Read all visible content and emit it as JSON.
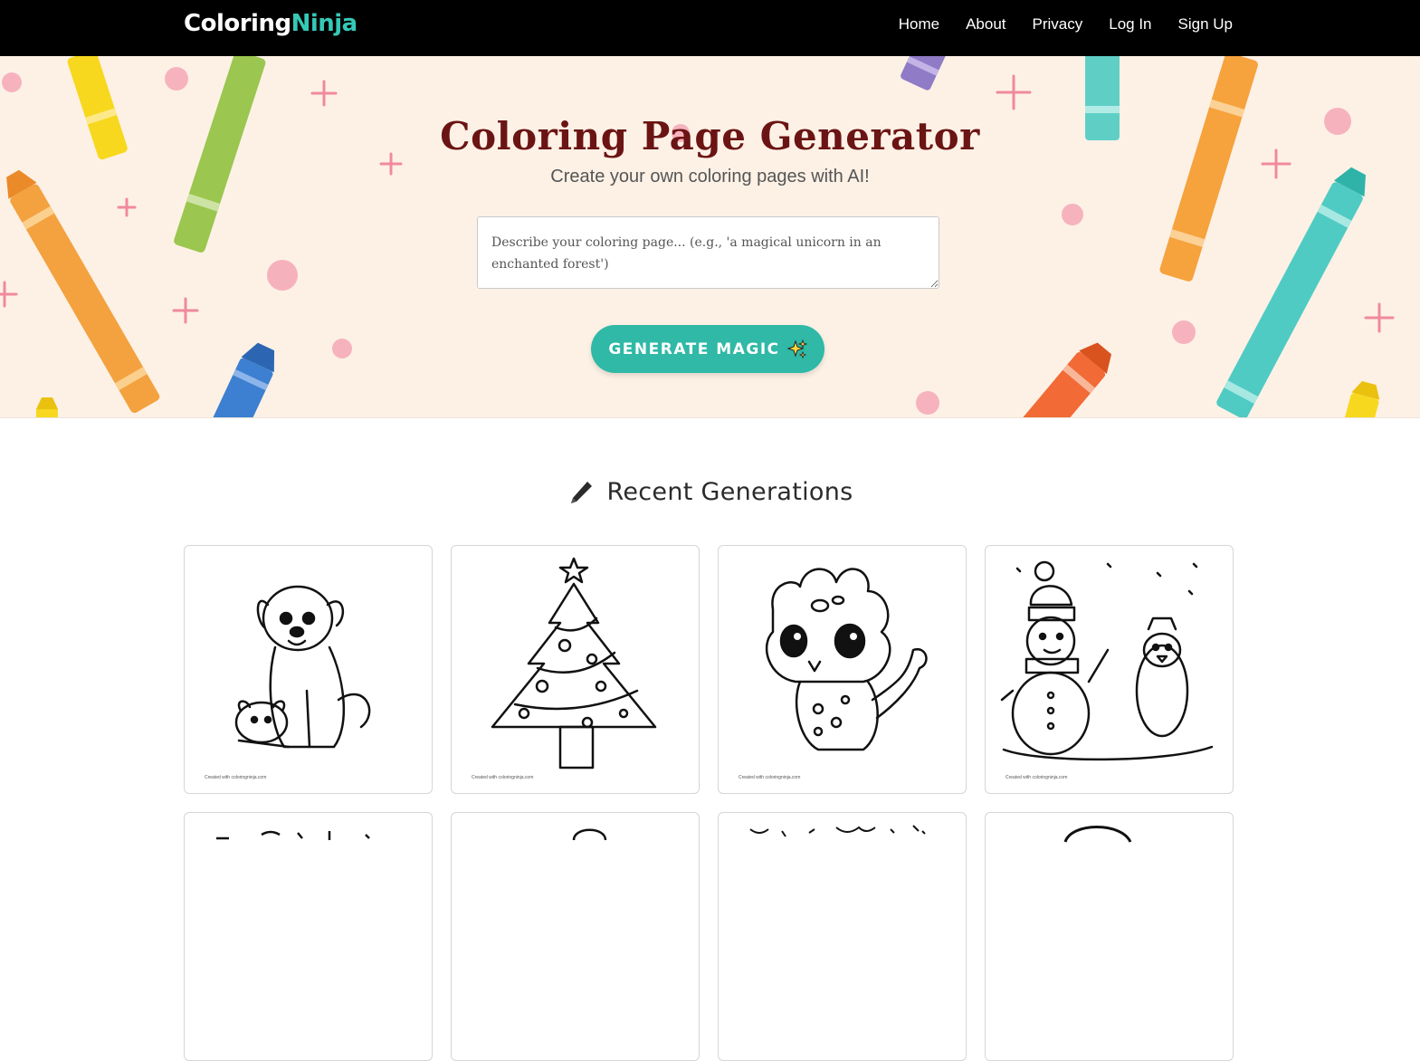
{
  "nav": {
    "logo_part1": "Coloring",
    "logo_part2": "Ninja",
    "links": [
      "Home",
      "About",
      "Privacy",
      "Log In",
      "Sign Up"
    ]
  },
  "hero": {
    "title": "Coloring Page Generator",
    "subtitle": "Create your own coloring pages with AI!",
    "prompt_placeholder": "Describe your coloring page... (e.g., 'a magical unicorn in an enchanted forest')",
    "button_label": "GENERATE MAGIC",
    "button_icon": "sparkles-icon"
  },
  "recent": {
    "heading": "Recent Generations",
    "heading_icon": "pencil-icon",
    "cards": [
      {
        "subject": "dog-with-puppy",
        "credit": "Created with coloringninja.com"
      },
      {
        "subject": "christmas-tree",
        "credit": "Created with coloringninja.com"
      },
      {
        "subject": "baby-dinosaur",
        "credit": "Created with coloringninja.com"
      },
      {
        "subject": "snowman-and-penguin",
        "credit": "Created with coloringninja.com"
      },
      {
        "subject": "partial",
        "credit": ""
      },
      {
        "subject": "partial",
        "credit": ""
      },
      {
        "subject": "partial",
        "credit": ""
      },
      {
        "subject": "partial",
        "credit": ""
      }
    ]
  },
  "colors": {
    "accent": "#2fb9a6",
    "logo_accent": "#35c9b6",
    "title": "#6b1414",
    "nav_bg": "#000000",
    "hero_bg": "#fdf1e6"
  }
}
